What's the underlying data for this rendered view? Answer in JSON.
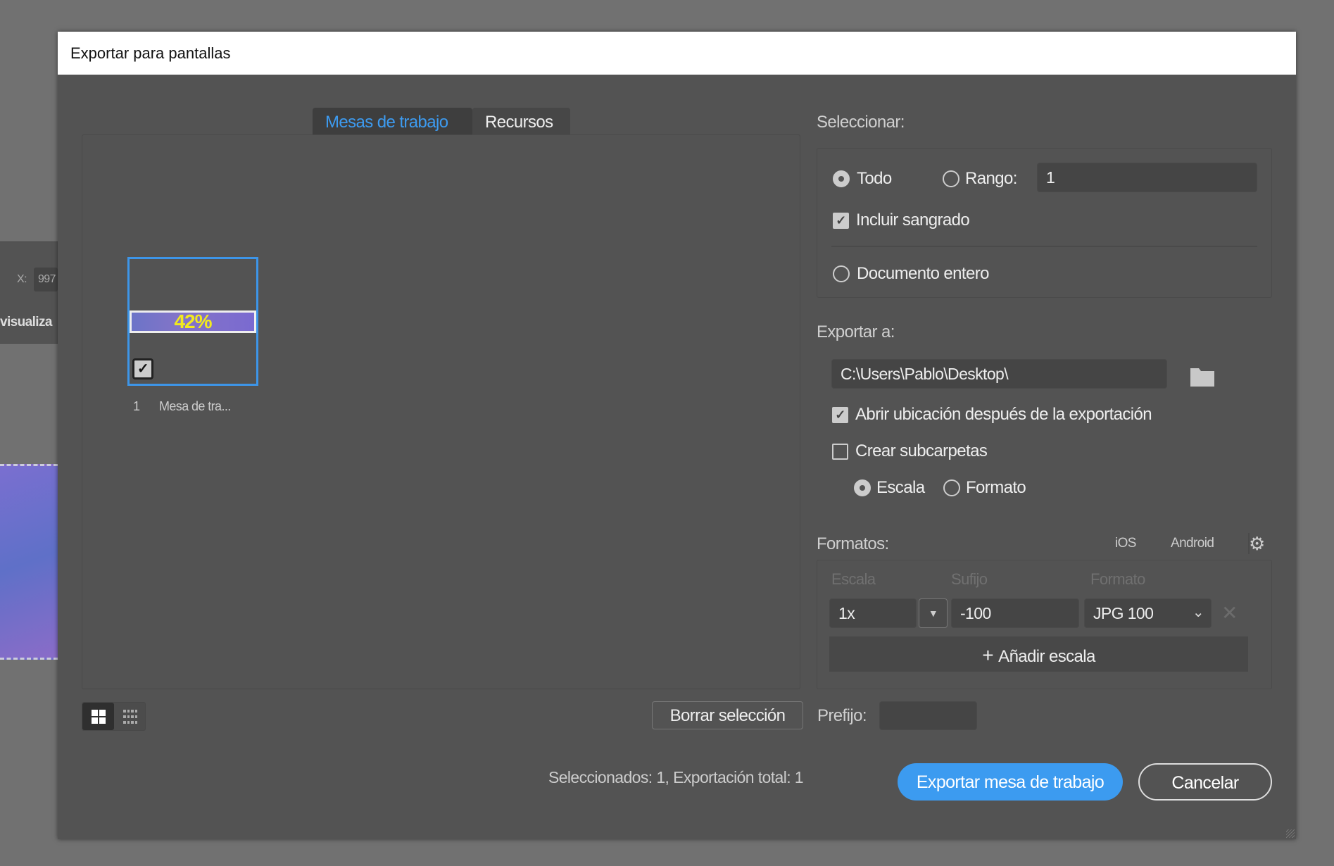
{
  "background": {
    "x_label": "X:",
    "x_value": "997",
    "visualiza_label": "visualiza"
  },
  "dialog": {
    "title": "Exportar para pantallas",
    "tabs": [
      {
        "label": "Mesas de trabajo",
        "active": true
      },
      {
        "label": "Recursos",
        "active": false
      }
    ],
    "artboards": [
      {
        "number": "1",
        "name": "Mesa de tra...",
        "checked": true,
        "preview_text": "42%"
      }
    ],
    "clear_selection_label": "Borrar selección",
    "status_text": "Seleccionados: 1, Exportación total: 1",
    "select": {
      "heading": "Seleccionar:",
      "all_label": "Todo",
      "range_label": "Rango:",
      "range_value": "1",
      "include_bleed_label": "Incluir sangrado",
      "whole_document_label": "Documento entero"
    },
    "export_to": {
      "heading": "Exportar a:",
      "path": "C:\\Users\\Pablo\\Desktop\\",
      "open_location_label": "Abrir ubicación después de la exportación",
      "create_subfolders_label": "Crear subcarpetas",
      "scale_label": "Escala",
      "format_label": "Formato"
    },
    "formats": {
      "heading": "Formatos:",
      "ios_label": "iOS",
      "android_label": "Android",
      "columns": [
        "Escala",
        "Sufijo",
        "Formato"
      ],
      "rows": [
        {
          "scale": "1x",
          "suffix": "-100",
          "format": "JPG 100"
        }
      ],
      "add_scale_label": "Añadir escala"
    },
    "prefix_label": "Prefijo:",
    "prefix_value": "",
    "export_button": "Exportar mesa de trabajo",
    "cancel_button": "Cancelar",
    "accent_color": "#3c9bf0"
  }
}
